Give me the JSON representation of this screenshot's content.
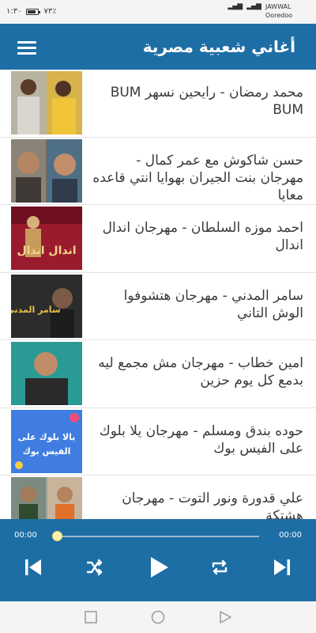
{
  "status_bar": {
    "time": "١:٣٠",
    "battery_text": "٧٣٪",
    "carrier_1": "JAWWAL",
    "carrier_2": "Ooredoo"
  },
  "header": {
    "title": "أغاني شعبية مصرية",
    "menu_icon": "hamburger-menu-icon"
  },
  "songs": [
    {
      "title": "محمد رمضان - رايحين نسهر BUM BUM"
    },
    {
      "title": "حسن شاكوش مع عمر كمال - مهرجان بنت الجيران بهوايا انتي قاعده معايا"
    },
    {
      "title": "احمد موزه السلطان - مهرجان اندال اندال"
    },
    {
      "title": "سامر المدني - مهرجان هتشوفوا الوش التاني"
    },
    {
      "title": "امين خطاب - مهرجان مش مجمع ليه بدمع كل يوم حزين"
    },
    {
      "title": "حوده بندق ومسلم - مهرجان يلا بلوك على الفيس بوك"
    },
    {
      "title": "علي قدورة ونور التوت - مهرجان هشتكة"
    }
  ],
  "thumbnails": {
    "t3_text": "اندال اندال",
    "t4_text": "سامر المدني",
    "t6_text_1": "يالا بلوك على",
    "t6_text_2": "الفيس بوك"
  },
  "player": {
    "current_time": "00:00",
    "total_time": "00:00",
    "progress": 0
  },
  "colors": {
    "primary": "#1e6ea6",
    "knob": "#fff3a6"
  }
}
